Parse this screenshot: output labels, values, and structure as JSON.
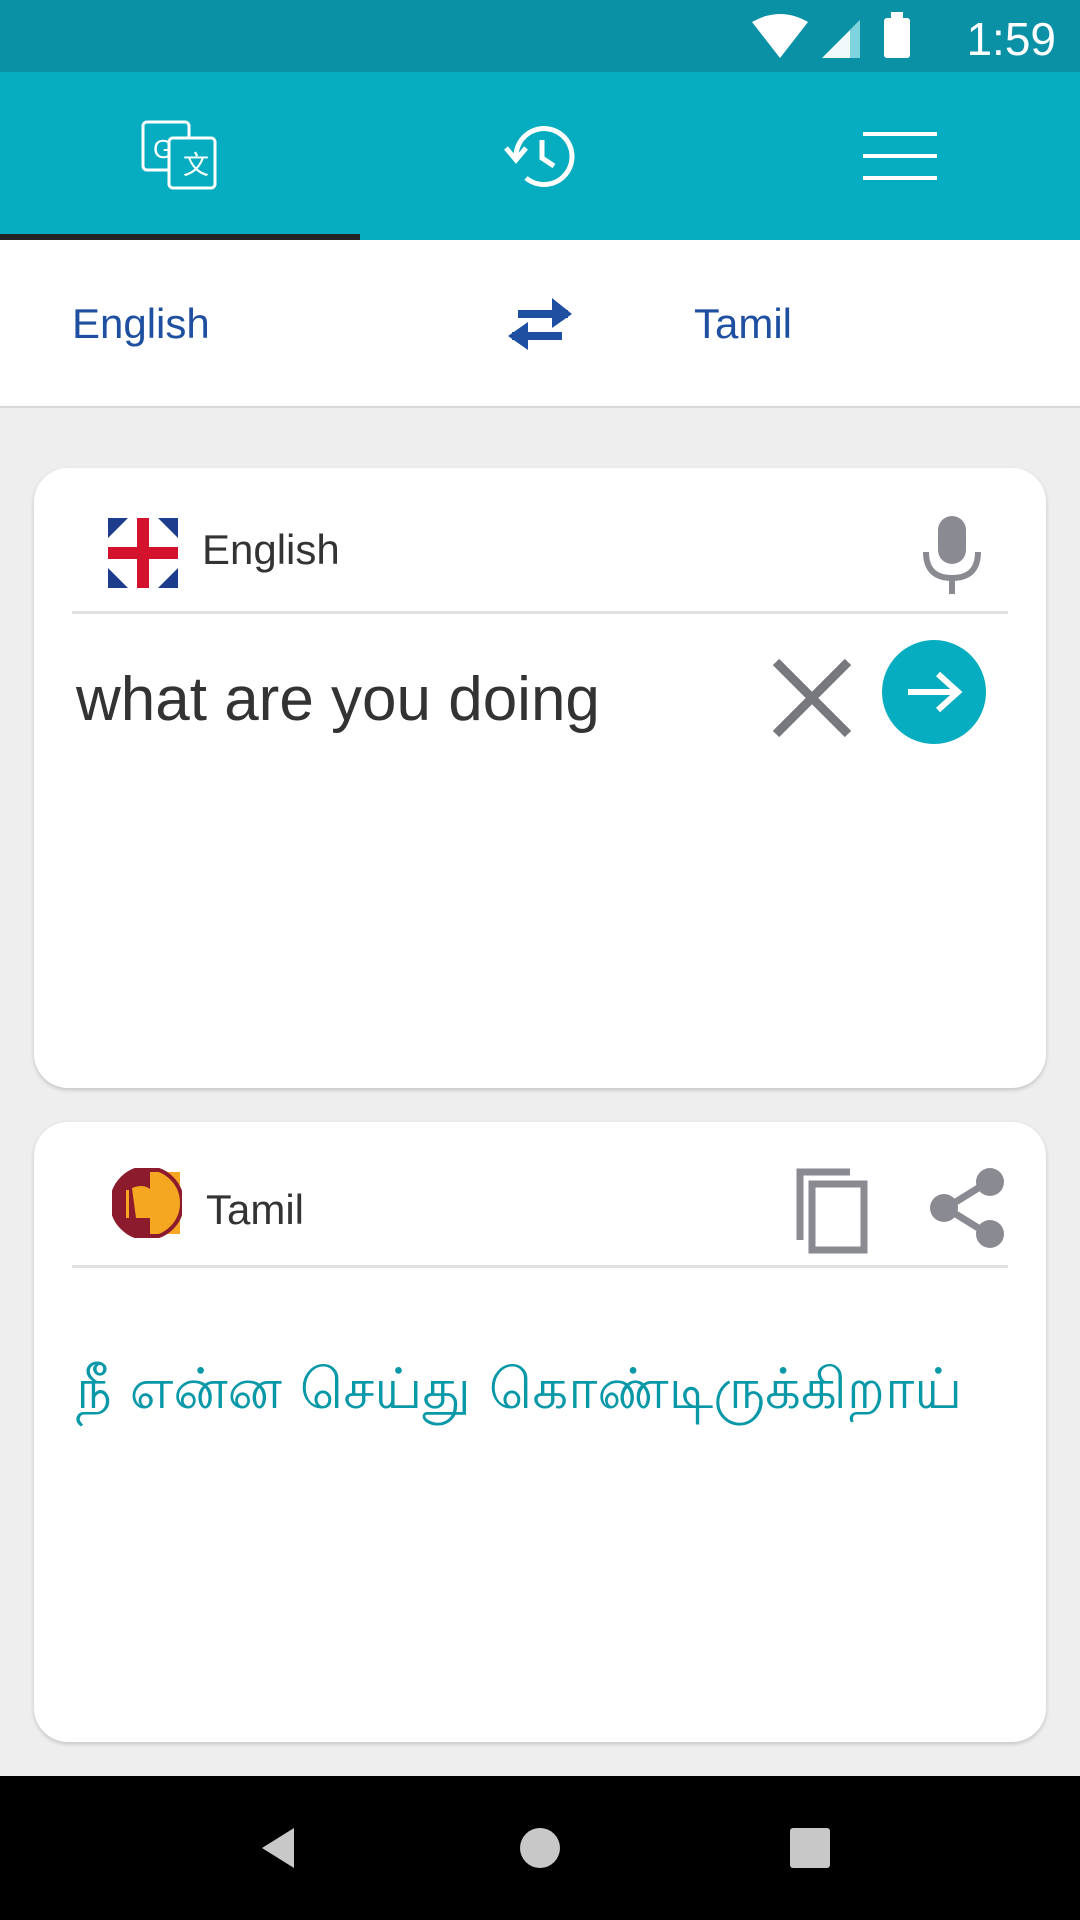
{
  "status_bar": {
    "time": "1:59"
  },
  "tabs": [
    {
      "icon": "translate-icon"
    },
    {
      "icon": "history-icon"
    },
    {
      "icon": "menu-icon"
    }
  ],
  "language_bar": {
    "source": "English",
    "target": "Tamil",
    "swap_icon": "swap-arrows-icon"
  },
  "input_card": {
    "language": "English",
    "text": "what are you doing",
    "mic_icon": "mic-icon",
    "clear_icon": "close-icon",
    "submit_icon": "arrow-right-icon"
  },
  "output_card": {
    "language": "Tamil",
    "text": "நீ என்ன செய்து கொண்டிருக்கிறாய்",
    "copy_icon": "copy-icon",
    "share_icon": "share-icon"
  },
  "colors": {
    "primary": "#06acbf",
    "status": "#0a91a6",
    "accent_text": "#1e4fa0",
    "output_text": "#0898a8"
  }
}
